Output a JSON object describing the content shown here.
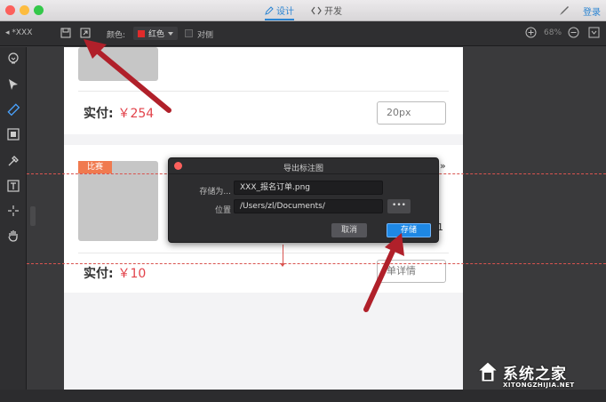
{
  "titlebar": {
    "tabs": [
      {
        "label": "设计",
        "active": true
      },
      {
        "label": "开发",
        "active": false
      }
    ],
    "login_label": "登录"
  },
  "toolbar": {
    "document_label": "*XXX",
    "color_label": "颜色:",
    "color_value": "红色",
    "color_hex": "#e02b2b",
    "checkbox_label": "对侧",
    "zoom_label": "68%"
  },
  "page": {
    "card1": {
      "price_prefix": "实付:",
      "price_value": "￥254",
      "button_label": "20px"
    },
    "card2": {
      "tag": "比赛",
      "price_prefix": "实付:",
      "price_value": "￥10",
      "button_label": "单详情",
      "side_quote": "»",
      "side_number": "1"
    }
  },
  "dialog": {
    "title": "导出标注图",
    "saveas_label": "存储为...",
    "filename": "XXX_报名订单.png",
    "location_label": "位置",
    "path": "/Users/zl/Documents/",
    "browse_label": "•••",
    "cancel_label": "取消",
    "save_label": "存储"
  },
  "watermark": {
    "name": "系统之家",
    "url": "XITONGZHIJIA.NET"
  },
  "colors": {
    "accent": "#2a84d2",
    "price_red": "#e2424a",
    "annotation_red": "#b0202a",
    "save_blue": "#1e88e5"
  }
}
